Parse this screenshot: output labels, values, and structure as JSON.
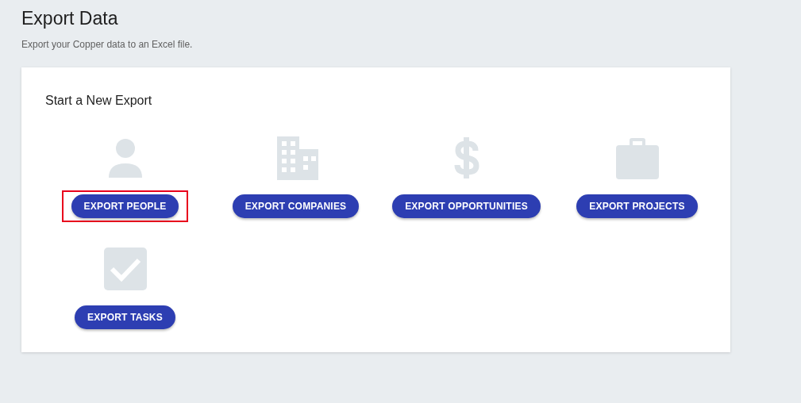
{
  "page": {
    "title": "Export Data",
    "subtitle": "Export your Copper data to an Excel file."
  },
  "panel": {
    "heading": "Start a New Export",
    "exports": [
      {
        "kind": "person",
        "label": "EXPORT PEOPLE",
        "highlighted": true
      },
      {
        "kind": "building",
        "label": "EXPORT COMPANIES",
        "highlighted": false
      },
      {
        "kind": "dollar",
        "label": "EXPORT OPPORTUNITIES",
        "highlighted": false
      },
      {
        "kind": "briefcase",
        "label": "EXPORT PROJECTS",
        "highlighted": false
      },
      {
        "kind": "check",
        "label": "EXPORT TASKS",
        "highlighted": false
      }
    ]
  }
}
